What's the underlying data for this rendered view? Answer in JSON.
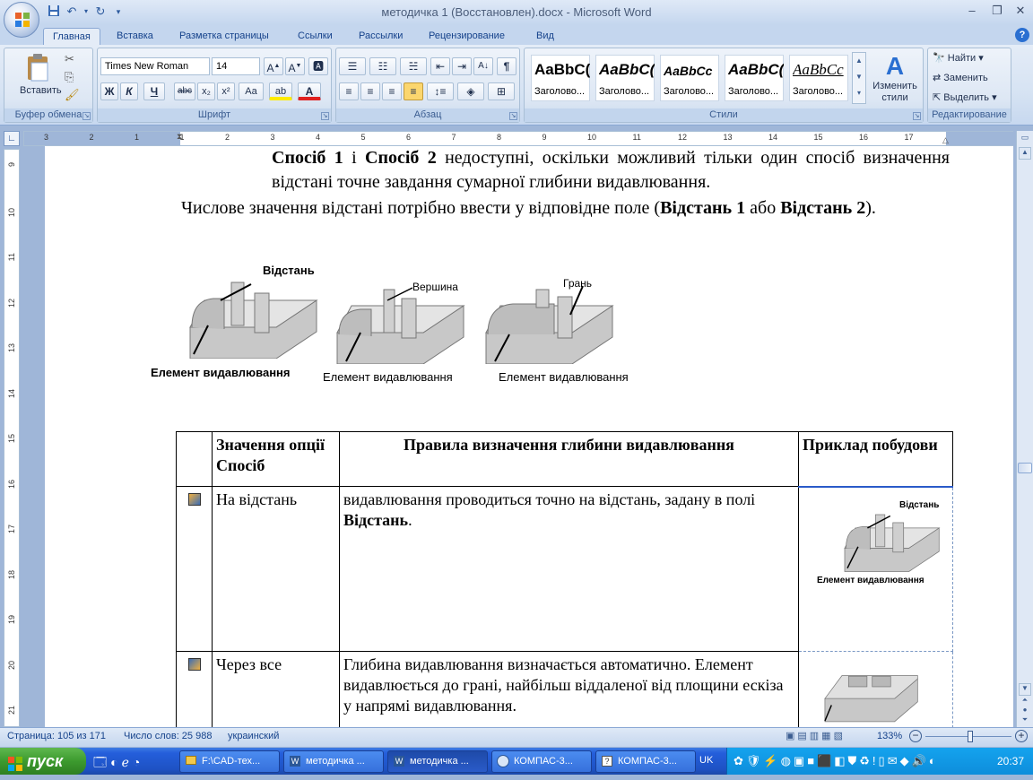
{
  "window": {
    "title": "методичка 1  (Восстановлен).docx - Microsoft Word",
    "controls": {
      "minimize": "–",
      "restore": "❐",
      "close": "✕",
      "ribbon_min": "–",
      "ribbon_restore": "▫",
      "ribbon_close": "✕"
    }
  },
  "quick_access": [
    {
      "name": "save-icon",
      "glyph": "💾"
    },
    {
      "name": "undo-icon",
      "glyph": "↶"
    },
    {
      "name": "redo-icon",
      "glyph": "↻"
    }
  ],
  "tabs": [
    "Главная",
    "Вставка",
    "Разметка страницы",
    "Ссылки",
    "Рассылки",
    "Рецензирование",
    "Вид"
  ],
  "ribbon": {
    "clipboard": {
      "label": "Буфер обмена",
      "paste": "Вставить"
    },
    "font": {
      "label": "Шрифт",
      "family": "Times New Roman",
      "size": "14"
    },
    "paragraph": {
      "label": "Абзац"
    },
    "styles": {
      "label": "Стили",
      "items": [
        {
          "preview": "AaBbC(",
          "name": "Заголово..."
        },
        {
          "preview": "AaBbC(",
          "name": "Заголово..."
        },
        {
          "preview": "AaBbCc",
          "name": "Заголово..."
        },
        {
          "preview": "AaBbC(",
          "name": "Заголово..."
        },
        {
          "preview": "AaBbCc",
          "name": "Заголово..."
        }
      ],
      "change": "Изменить стили"
    },
    "editing": {
      "label": "Редактирование",
      "find": "Найти",
      "replace": "Заменить",
      "select": "Выделить"
    }
  },
  "ruler": {
    "h_ticks": [
      "3",
      "2",
      "1",
      "1",
      "2",
      "3",
      "4",
      "5",
      "6",
      "7",
      "8",
      "9",
      "10",
      "11",
      "12",
      "13",
      "14",
      "15",
      "16",
      "17"
    ],
    "v_ticks": [
      "9",
      "10",
      "11",
      "12",
      "13",
      "14",
      "15",
      "16",
      "17",
      "18",
      "19",
      "20",
      "21"
    ]
  },
  "document": {
    "para1": {
      "b1": "Спосіб 1",
      "t1": " і ",
      "b2": "Спосіб 2",
      "t2": " недоступні, оскільки можливий тільки один спосіб визначення відстані  точне завдання сумарної глибини видавлювання."
    },
    "para2": {
      "t1": "Числове значення відстані потрібно ввести у відповідне поле (",
      "b1": "Відстань 1",
      "t2": " або ",
      "b2": "Відстань 2",
      "t3": ")."
    },
    "figures": [
      {
        "label": "Відстань",
        "caption": "Елемент видавлювання"
      },
      {
        "label": "Вершина",
        "caption": "Елемент видавлювання"
      },
      {
        "label": "Грань",
        "caption": "Елемент видавлювання"
      }
    ],
    "table": {
      "headers": [
        "",
        "Значення опції Спосіб",
        "Правила визначення глибини видавлювання",
        "Приклад побудови"
      ],
      "rows": [
        {
          "option": "На відстань",
          "rule_t1": "видавлювання проводиться точно на відстань, задану в полі ",
          "rule_b": "Відстань",
          "rule_t2": ".",
          "ex_label": "Відстань",
          "ex_caption": "Елемент видавлювання"
        },
        {
          "option": "Через все",
          "rule_t1": "Глибина видавлювання визначається автоматично. Елемент видавлюється до грані, найбільш віддаленої від площини ескіза у напрямі видавлювання.",
          "rule_b": "",
          "rule_t2": ""
        }
      ]
    }
  },
  "status": {
    "page": "Страница: 105 из 171",
    "words": "Число слов: 25 988",
    "lang": "украинский",
    "zoom": "133%"
  },
  "taskbar": {
    "start": "пуск",
    "tasks": [
      "F:\\CAD-тех...",
      "методичка ...",
      "методичка ...",
      "КОМПАС-3...",
      "КОМПАС-3..."
    ],
    "active_task": 2,
    "lang": "UK",
    "clock": "20:37"
  }
}
